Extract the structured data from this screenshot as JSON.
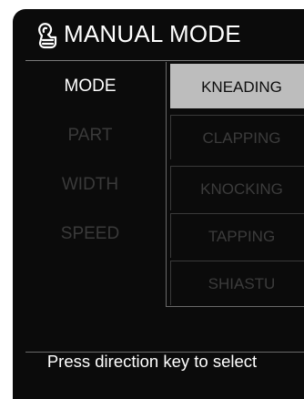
{
  "header": {
    "title": "MANUAL MODE",
    "icon": "massage-hand-icon"
  },
  "menu": {
    "labels": [
      {
        "label": "MODE",
        "active": true
      },
      {
        "label": "PART",
        "active": false
      },
      {
        "label": "WIDTH",
        "active": false
      },
      {
        "label": "SPEED",
        "active": false
      }
    ]
  },
  "options": [
    {
      "label": "KNEADING",
      "selected": true
    },
    {
      "label": "CLAPPING",
      "selected": false
    },
    {
      "label": "KNOCKING",
      "selected": false
    },
    {
      "label": "TAPPING",
      "selected": false
    },
    {
      "label": "SHIASTU",
      "selected": false
    }
  ],
  "footer": {
    "hint": "Press direction key to select"
  },
  "colors": {
    "background": "#0b0b0b",
    "text_active": "#ffffff",
    "text_inactive": "#3a3a3a",
    "selection": "#bdbdbd"
  }
}
